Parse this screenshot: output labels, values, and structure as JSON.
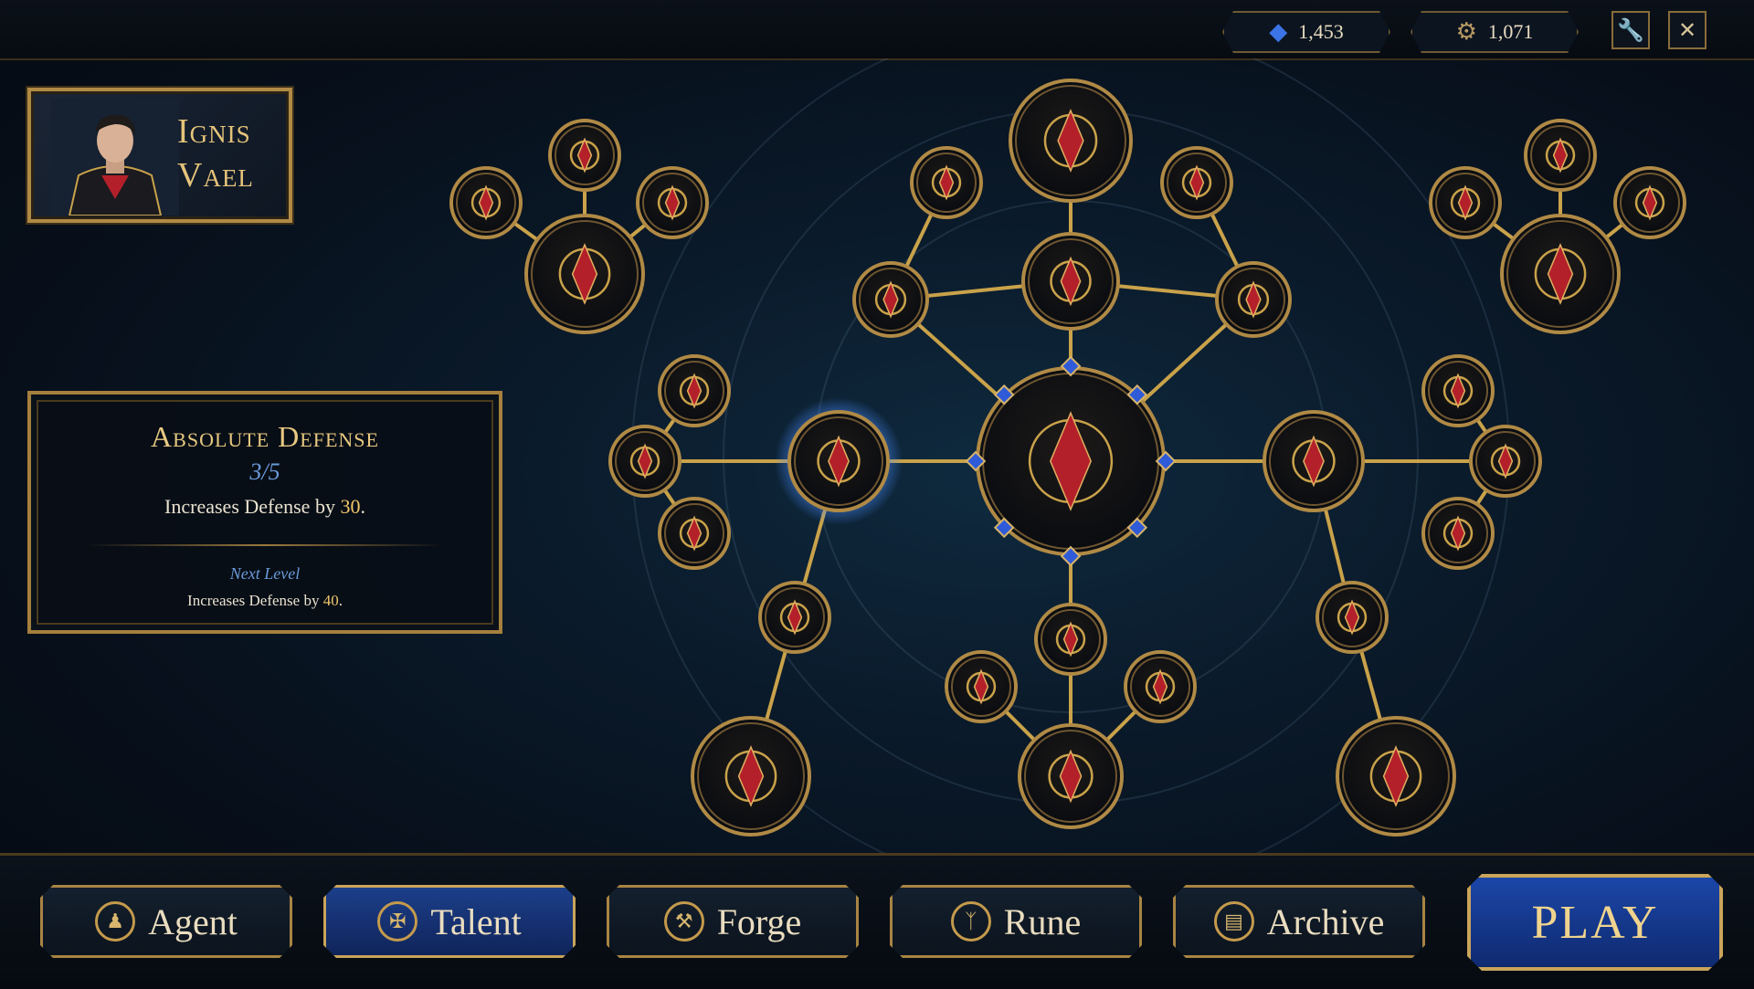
{
  "currencies": {
    "gems": {
      "value": "1,453",
      "icon": "blue-crystal-icon"
    },
    "gears": {
      "value": "1,071",
      "icon": "gear-icon"
    }
  },
  "top_buttons": [
    {
      "icon": "wrench-icon"
    },
    {
      "icon": "close-icon"
    }
  ],
  "hero": {
    "name_line1": "Ignis",
    "name_line2": "Vael"
  },
  "tooltip": {
    "title": "Absolute Defense",
    "level": "3/5",
    "desc_prefix": "Increases Defense by ",
    "desc_value": "30",
    "desc_suffix": ".",
    "next_label": "Next Level",
    "next_prefix": "Increases Defense by ",
    "next_value": "40",
    "next_suffix": "."
  },
  "talent_tree": {
    "selected_node": "absolute-defense",
    "colors": {
      "gold": "#b08a45",
      "line": "#c9a24a",
      "ruby": "#b3202a",
      "sapphire": "#2f5bd8",
      "glow": "#3a7bd5"
    },
    "nodes": [
      {
        "id": "core",
        "icon": "compass-crest-icon"
      },
      {
        "id": "absolute-defense",
        "icon": "shield-icon"
      },
      {
        "id": "left-shield-top",
        "icon": "shield-gem-icon"
      },
      {
        "id": "left-shield-mid",
        "icon": "shield-gem-icon"
      },
      {
        "id": "left-shield-bottom",
        "icon": "gem-badge-icon"
      },
      {
        "id": "sound-wave",
        "icon": "sound-wave-icon"
      },
      {
        "id": "crown-shield",
        "icon": "crown-shield-icon"
      },
      {
        "id": "arrow-spread",
        "icon": "arrow-spread-icon"
      },
      {
        "id": "orbit",
        "icon": "orbit-icon"
      },
      {
        "id": "sparkle-left",
        "icon": "sparkle-icon"
      },
      {
        "id": "sun-star",
        "icon": "sun-star-icon"
      },
      {
        "id": "trident",
        "icon": "trident-icon"
      },
      {
        "id": "gem-pool",
        "icon": "gem-pool-icon"
      },
      {
        "id": "crosshair",
        "icon": "crosshair-icon"
      },
      {
        "id": "pin-gem",
        "icon": "pin-gem-icon"
      },
      {
        "id": "compass-star",
        "icon": "compass-star-icon"
      },
      {
        "id": "spear",
        "icon": "spear-icon"
      },
      {
        "id": "vault",
        "icon": "vault-icon"
      },
      {
        "id": "chest",
        "icon": "chest-icon"
      },
      {
        "id": "target-gem",
        "icon": "target-gem-icon"
      },
      {
        "id": "magnify-gem",
        "icon": "magnify-gem-icon"
      },
      {
        "id": "swift-arrow",
        "icon": "swift-arrow-icon"
      },
      {
        "id": "gem-pin-top",
        "icon": "gem-pin-icon"
      },
      {
        "id": "gem-pin-mid",
        "icon": "gem-pin-icon"
      },
      {
        "id": "fountain",
        "icon": "fountain-icon"
      },
      {
        "id": "boot",
        "icon": "boot-icon"
      },
      {
        "id": "gem-sigil",
        "icon": "gem-sigil-icon"
      },
      {
        "id": "scroll",
        "icon": "scroll-icon"
      },
      {
        "id": "book-open",
        "icon": "open-book-icon"
      },
      {
        "id": "tome",
        "icon": "tome-icon"
      },
      {
        "id": "card",
        "icon": "card-icon"
      }
    ]
  },
  "nav": [
    {
      "label": "Agent",
      "icon": "agent-icon",
      "active": false
    },
    {
      "label": "Talent",
      "icon": "talent-icon",
      "active": true
    },
    {
      "label": "Forge",
      "icon": "anvil-icon",
      "active": false
    },
    {
      "label": "Rune",
      "icon": "rune-icon",
      "active": false
    },
    {
      "label": "Archive",
      "icon": "archive-book-icon",
      "active": false
    }
  ],
  "play_label": "PLAY"
}
